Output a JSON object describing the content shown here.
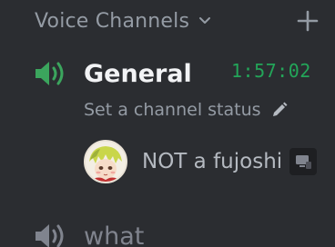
{
  "category": {
    "label": "Voice Channels",
    "chevron_icon": "chevron-down-icon",
    "add_icon": "plus-icon"
  },
  "channels": [
    {
      "name": "General",
      "icon": "speaker-icon",
      "active": true,
      "timer": "1:57:02",
      "status_placeholder": "Set a channel status",
      "status_icon": "pencil-icon",
      "users": [
        {
          "name": "NOT a fujoshi",
          "avatar_icon": "anime-avatar",
          "badge_icon": "streaming-badge-icon"
        }
      ]
    },
    {
      "name": "what",
      "icon": "speaker-icon",
      "active": false
    }
  ],
  "colors": {
    "background": "#2b2d31",
    "active_icon": "#3ba55d",
    "timer": "#23a559",
    "muted_text": "#949ba4",
    "bright_text": "#f2f3f5"
  }
}
